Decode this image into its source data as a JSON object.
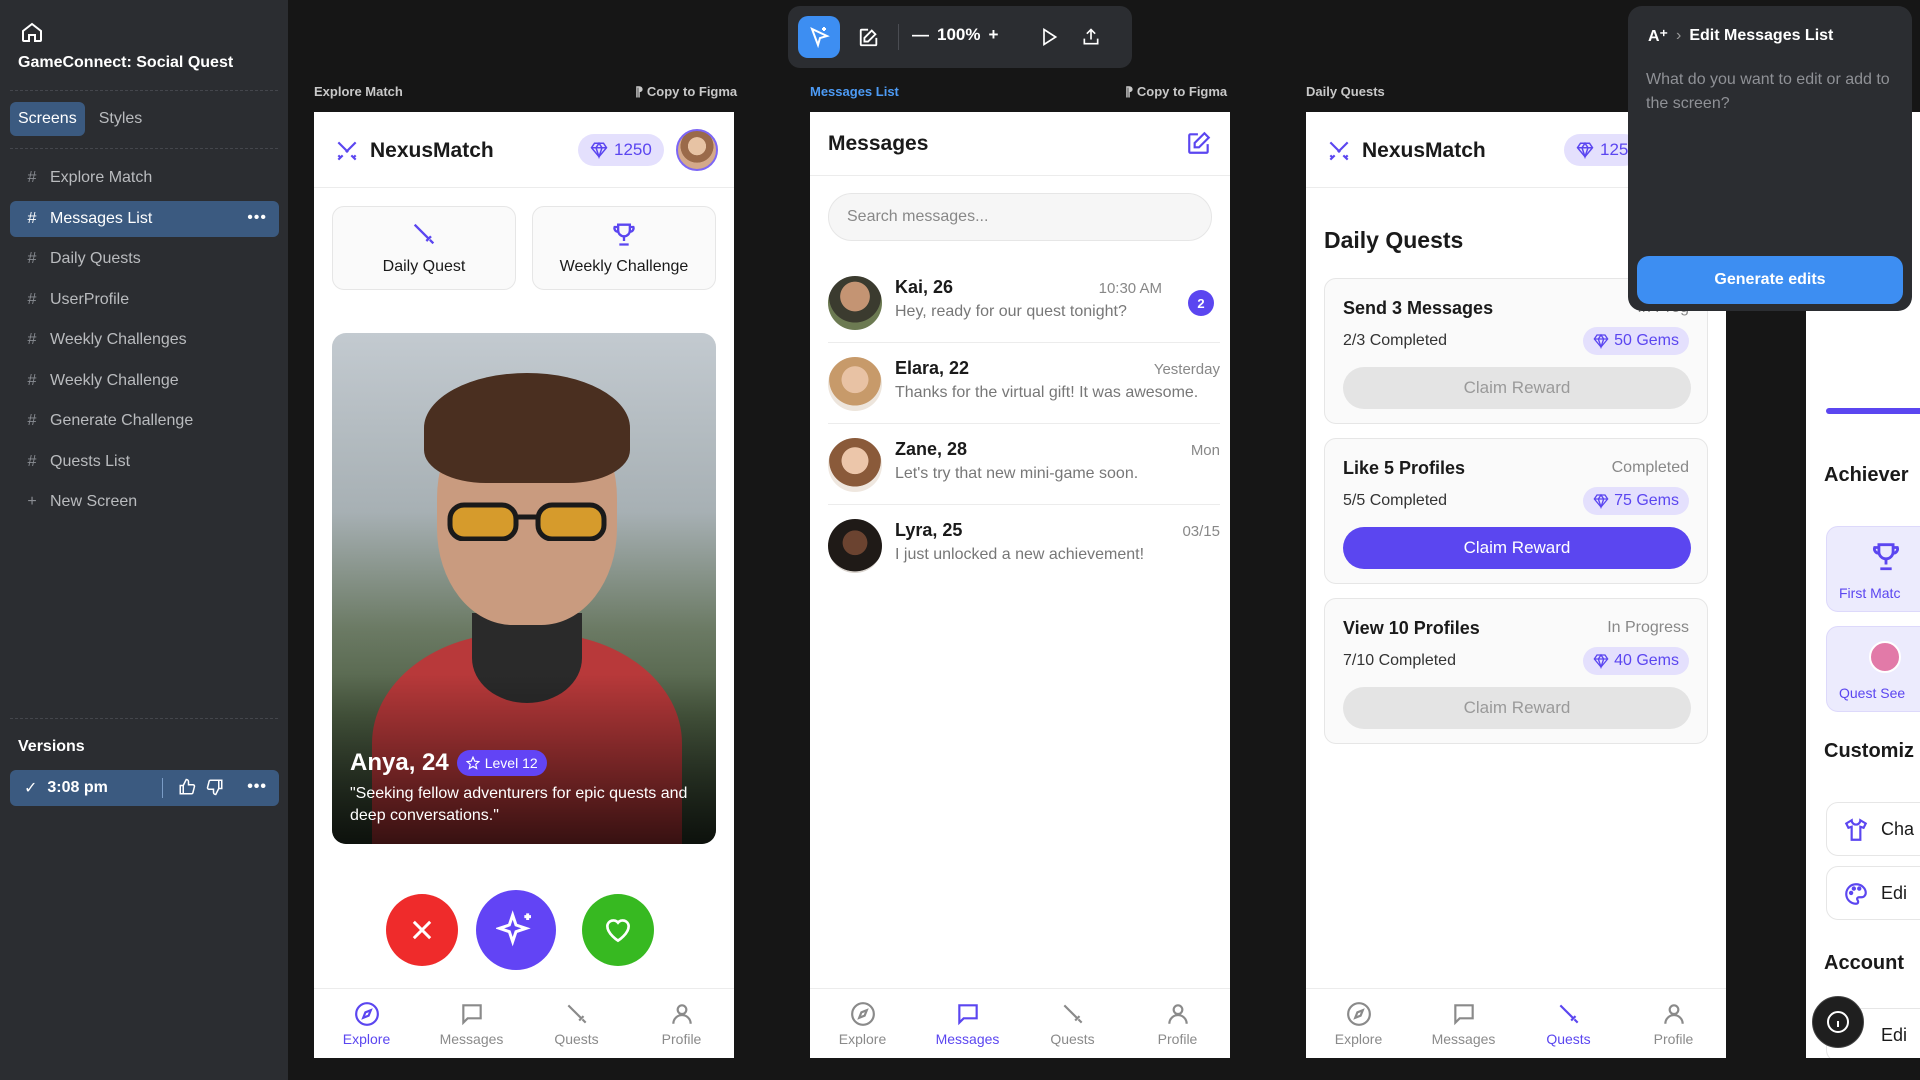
{
  "sidebar": {
    "project_title": "GameConnect: Social Quest",
    "tabs": [
      "Screens",
      "Styles"
    ],
    "screens": [
      "Explore Match",
      "Messages List",
      "Daily Quests",
      "UserProfile",
      "Weekly Challenges",
      "Weekly Challenge",
      "Generate Challenge",
      "Quests List"
    ],
    "new_screen": "New Screen",
    "versions_label": "Versions",
    "version_time": "3:08 pm"
  },
  "toolbar": {
    "zoom": "100%"
  },
  "frames": {
    "explore": {
      "label": "Explore Match",
      "copy": "Copy to Figma"
    },
    "messages": {
      "label": "Messages List",
      "copy": "Copy to Figma"
    },
    "quests": {
      "label": "Daily Quests"
    }
  },
  "app": {
    "brand": "NexusMatch",
    "gems": "1250",
    "gems_cropped": "125",
    "tabs": [
      "Explore",
      "Messages",
      "Quests",
      "Profile"
    ]
  },
  "explore": {
    "quick": [
      "Daily Quest",
      "Weekly Challenge"
    ],
    "profile": {
      "name": "Anya, 24",
      "level": "Level 12",
      "bio": "\"Seeking fellow adventurers for epic quests and deep conversations.\""
    }
  },
  "messages": {
    "title": "Messages",
    "search_placeholder": "Search messages...",
    "chats": [
      {
        "name": "Kai, 26",
        "time": "10:30 AM",
        "preview": "Hey, ready for our quest tonight?",
        "badge": "2"
      },
      {
        "name": "Elara, 22",
        "time": "Yesterday",
        "preview": "Thanks for the virtual gift! It was awesome."
      },
      {
        "name": "Zane, 28",
        "time": "Mon",
        "preview": "Let's try that new mini-game soon."
      },
      {
        "name": "Lyra, 25",
        "time": "03/15",
        "preview": "I just unlocked a new achievement!"
      }
    ]
  },
  "quests": {
    "title": "Daily Quests",
    "items": [
      {
        "title": "Send 3 Messages",
        "status": "In Prog",
        "progress": "2/3 Completed",
        "gems": "50 Gems",
        "button": "Claim Reward"
      },
      {
        "title": "Like 5 Profiles",
        "status": "Completed",
        "progress": "5/5 Completed",
        "gems": "75 Gems",
        "button": "Claim Reward"
      },
      {
        "title": "View 10 Profiles",
        "status": "In Progress",
        "progress": "7/10 Completed",
        "gems": "40 Gems",
        "button": "Claim Reward"
      }
    ]
  },
  "edit_panel": {
    "crumb": "Edit Messages List",
    "placeholder": "What do you want to edit or add to the screen?",
    "button": "Generate edits"
  },
  "profile_peek": {
    "achievements": "Achiever",
    "tile1": "First Matc",
    "tile2": "Quest See",
    "customize": "Customiz",
    "row1": "Cha",
    "row2": "Edi",
    "account": "Account",
    "row3": "Edi"
  },
  "colors": {
    "accent": "#5b46f0",
    "selection": "#3b5a80",
    "primary_blue": "#3d8ef2"
  }
}
